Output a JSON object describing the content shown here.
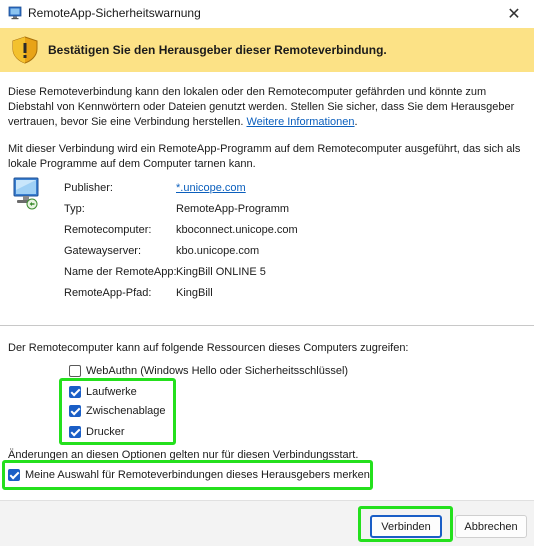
{
  "window": {
    "title": "RemoteApp-Sicherheitswarnung",
    "close_glyph": "✕"
  },
  "banner": {
    "text": "Bestätigen Sie den Herausgeber dieser Remoteverbindung.",
    "icon": "shield-warning-icon",
    "background": "#fce286"
  },
  "intro": {
    "line1": "Diese Remoteverbindung kann den lokalen oder den Remotecomputer gefährden und könnte zum",
    "line2": "Diebstahl von Kennwörtern oder Dateien genutzt werden. Stellen Sie sicher, dass Sie dem Herausgeber",
    "line3_prefix": "vertrauen, bevor Sie eine Verbindung herstellen.",
    "link": "Weitere Informationen",
    "line3_suffix": "."
  },
  "notice": {
    "line1": "Mit dieser Verbindung wird ein RemoteApp-Programm auf dem Remotecomputer ausgeführt, das sich als",
    "line2": "lokale Programme auf dem Computer tarnen kann."
  },
  "details": {
    "icon": "remote-computer-icon",
    "rows": [
      {
        "label": "Publisher:",
        "value": "*.unicope.com",
        "is_link": true
      },
      {
        "label": "Typ:",
        "value": "RemoteApp-Programm",
        "is_link": false
      },
      {
        "label": "Remotecomputer:",
        "value": "kboconnect.unicope.com",
        "is_link": false
      },
      {
        "label": "Gatewayserver:",
        "value": "kbo.unicope.com",
        "is_link": false
      },
      {
        "label": "Name der RemoteApp:",
        "value": "KingBill ONLINE 5",
        "is_link": false
      },
      {
        "label": "RemoteApp-Pfad:",
        "value": "KingBill",
        "is_link": false
      }
    ]
  },
  "resources": {
    "heading": "Der Remotecomputer kann auf folgende Ressourcen dieses Computers zugreifen:",
    "items": [
      {
        "label": "WebAuthn (Windows Hello oder Sicherheitsschlüssel)",
        "checked": false
      },
      {
        "label": "Laufwerke",
        "checked": true
      },
      {
        "label": "Zwischenablage",
        "checked": true
      },
      {
        "label": "Drucker",
        "checked": true
      }
    ],
    "note": "Änderungen an diesen Optionen gelten nur für diesen Verbindungsstart."
  },
  "remember": {
    "label": "Meine Auswahl für Remoteverbindungen dieses Herausgebers merken",
    "checked": true
  },
  "buttons": {
    "connect": "Verbinden",
    "cancel": "Abbrechen"
  },
  "colors": {
    "accent": "#1a5ec6",
    "link": "#0b5fbd",
    "highlight": "#24e01d"
  }
}
